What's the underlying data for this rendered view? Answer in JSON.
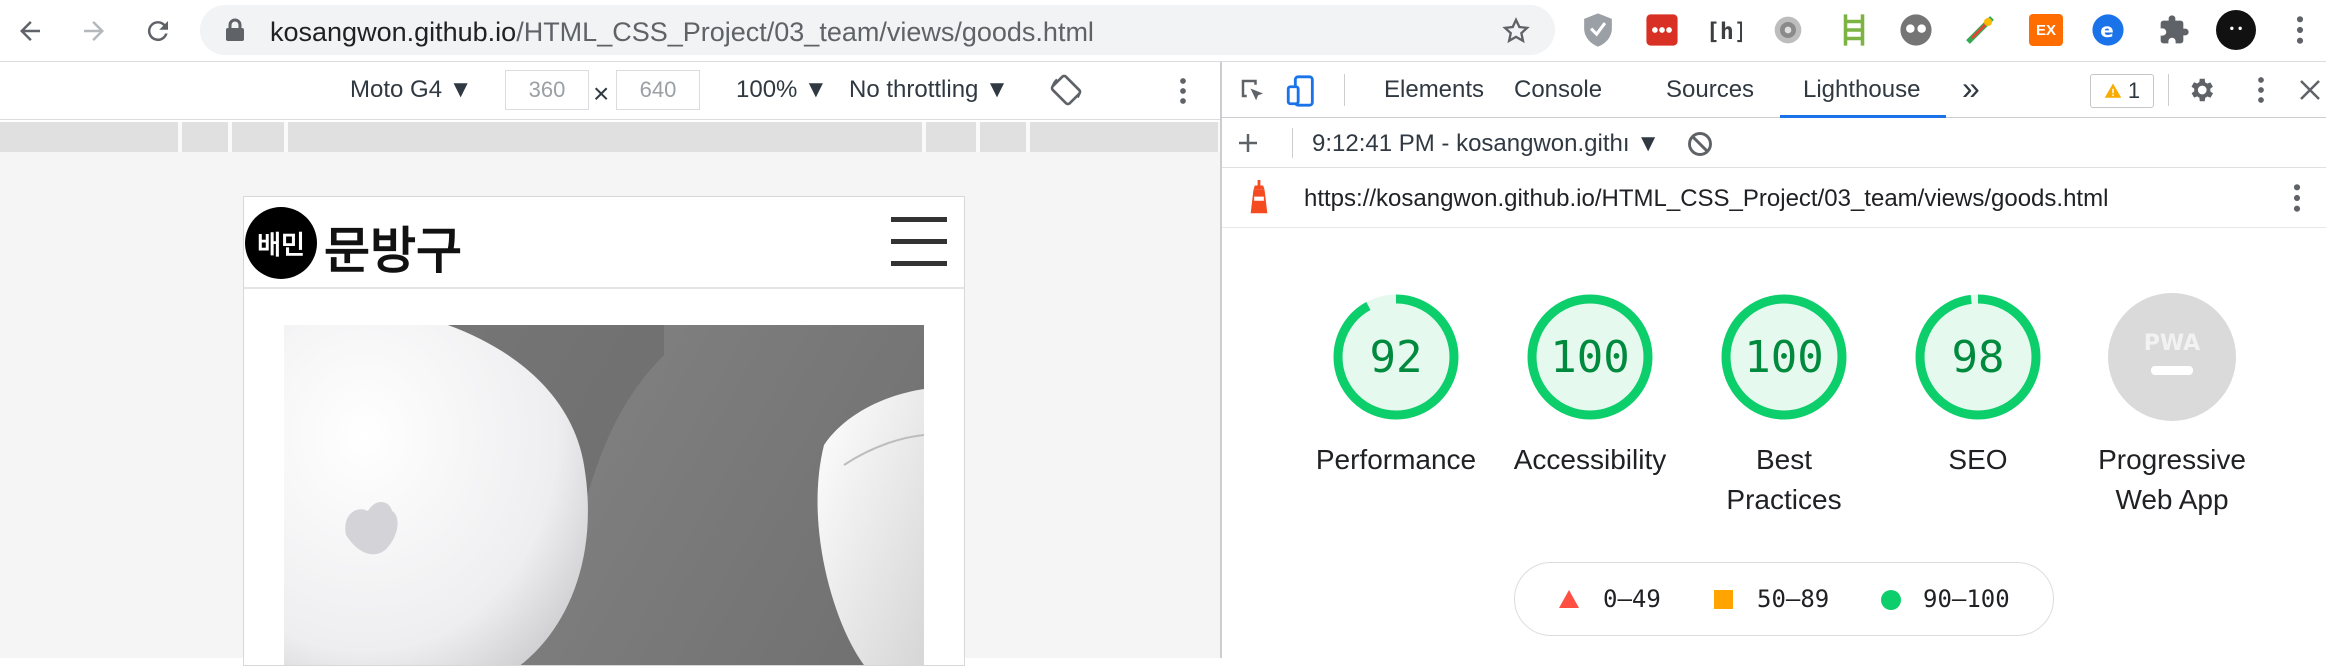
{
  "browser": {
    "url_host": "kosangwon.github.io",
    "url_path": "/HTML_CSS_Project/03_team/views/goods.html",
    "extensions": [
      "shield-icon",
      "mail-ext-icon",
      "hash-ext-icon",
      "gear-ext-icon",
      "ladder-ext-icon",
      "glasses-ext-icon",
      "color-ext-icon",
      "ex-ext-icon",
      "e-ext-icon",
      "puzzle-icon",
      "profile-avatar"
    ],
    "ext_ex_label": "EX"
  },
  "device_toolbar": {
    "device": "Moto G4",
    "width": "360",
    "height": "640",
    "times": "×",
    "zoom": "100%",
    "throttling": "No throttling"
  },
  "site": {
    "logo_badge": "배민",
    "logo_text": "문방구"
  },
  "devtools": {
    "tabs": [
      "Elements",
      "Console",
      "Sources",
      "Lighthouse"
    ],
    "active_tab": "Lighthouse",
    "more_tabs": "»",
    "warning_count": "1",
    "report_label": "9:12:41 PM - kosangwon.githı",
    "report_url": "https://kosangwon.github.io/HTML_CSS_Project/03_team/views/goods.html"
  },
  "lighthouse": {
    "scores": [
      {
        "label_lines": [
          "Performance"
        ],
        "score": "92",
        "value": 92
      },
      {
        "label_lines": [
          "Accessibility"
        ],
        "score": "100",
        "value": 100
      },
      {
        "label_lines": [
          "Best",
          "Practices"
        ],
        "score": "100",
        "value": 100
      },
      {
        "label_lines": [
          "SEO"
        ],
        "score": "98",
        "value": 98
      }
    ],
    "pwa": {
      "badge": "PWA",
      "label_lines": [
        "Progressive",
        "Web App"
      ]
    },
    "legend": [
      "0–49",
      "50–89",
      "90–100"
    ],
    "colors": {
      "fail": "#ff4e42",
      "average": "#ffa400",
      "pass": "#0cce6b",
      "pass_text": "#008a3e",
      "pass_bg": "#e6f9ee"
    }
  }
}
